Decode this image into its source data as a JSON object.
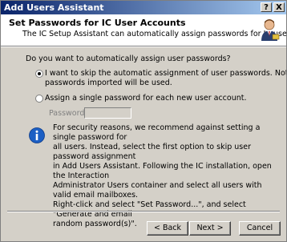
{
  "window": {
    "title": "Add Users Assistant",
    "help_glyph": "?",
    "close_glyph": "X"
  },
  "header": {
    "title": "Set Passwords for IC User Accounts",
    "subtitle": "The IC Setup Assistant can automatically assign passwords for IC user accounts.",
    "icon": "user-icon"
  },
  "body": {
    "question": "Do you want to automatically assign user passwords?",
    "options": [
      {
        "label_line1": "I want to skip the automatic assignment of user passwords. Note that any",
        "label_line2": "passwords imported will be used.",
        "selected": true
      },
      {
        "label_line1": "Assign a single password for each new user account.",
        "selected": false
      }
    ],
    "password_label": "Password:",
    "password_value": "",
    "info_icon": "info-icon",
    "info_lines": [
      "For security reasons, we recommend against setting a single password for",
      "all users. Instead, select the first option to skip user password assignment",
      "in Add Users Assistant. Following the IC installation, open the Interaction",
      "Administrator Users container and select all users with valid email mailboxes.",
      "Right-click and select \"Set Password...\", and select \"Generate and email",
      "random password(s)\"."
    ]
  },
  "buttons": {
    "back": "< Back",
    "next": "Next >",
    "cancel": "Cancel"
  },
  "colors": {
    "title_gradient_start": "#0a246a",
    "title_gradient_end": "#a6caf0",
    "dialog_face": "#d4d0c8",
    "info_blue": "#1c5fc4"
  }
}
